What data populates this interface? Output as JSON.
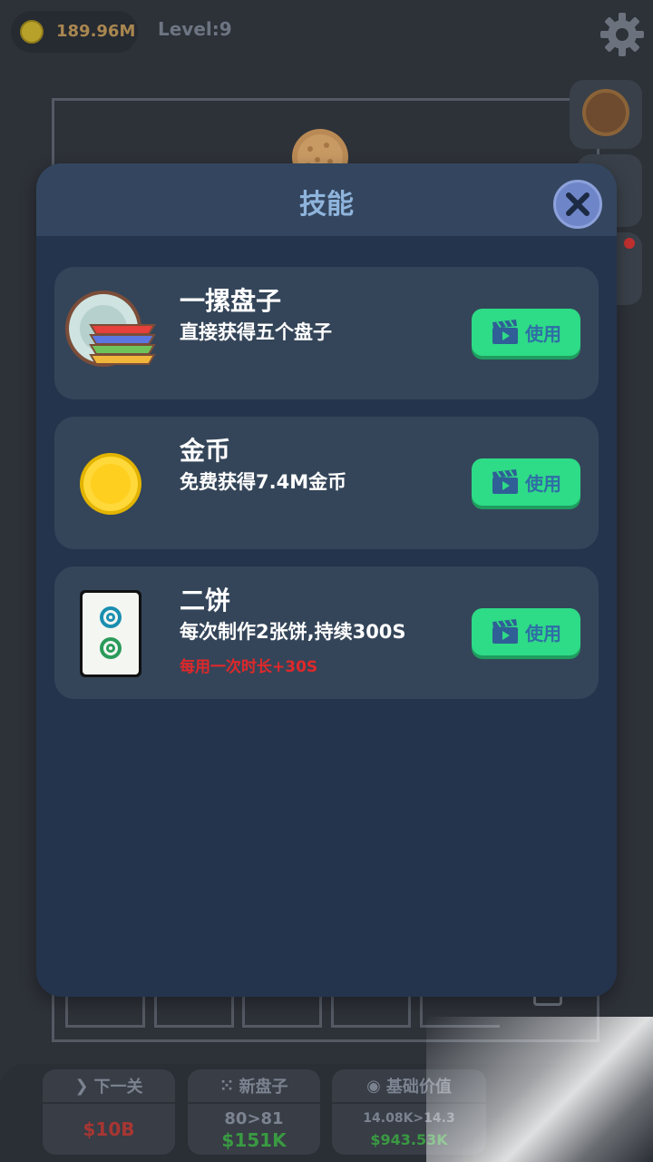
{
  "hud": {
    "coins": "189.96M",
    "level": "Level:9"
  },
  "modal": {
    "title": "技能",
    "skills": [
      {
        "name": "一摞盘子",
        "desc": "直接获得五个盘子",
        "note": "",
        "button": "使用"
      },
      {
        "name": "金币",
        "desc": "免费获得7.4M金币",
        "note": "",
        "button": "使用"
      },
      {
        "name": "二饼",
        "desc": "每次制作2张饼,持续300S",
        "note": "每用一次时长+30S",
        "button": "使用"
      }
    ]
  },
  "bottom_bar": {
    "next_level": {
      "title": "下一关",
      "price": "$10B"
    },
    "new_plate": {
      "title": "新盘子",
      "range": "80>81",
      "price": "$151K"
    },
    "base_value": {
      "title": "基础价值",
      "range": "14.08K>14.3",
      "price": "$943.53K"
    }
  },
  "colors": {
    "modal_bg": "#25344d",
    "card_bg": "#344559",
    "use_button": "#2edb86",
    "note_red": "#e0282a",
    "title_blue": "#8fb4dc"
  }
}
